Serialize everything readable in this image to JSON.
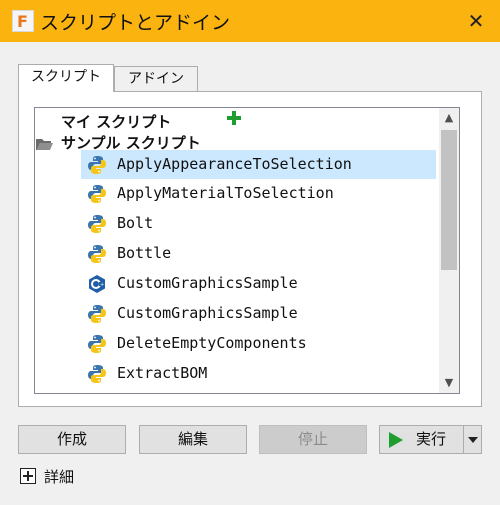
{
  "window": {
    "title": "スクリプトとアドイン",
    "close_glyph": "✕"
  },
  "tabs": [
    {
      "label": "スクリプト",
      "active": true
    },
    {
      "label": "アドイン",
      "active": false
    }
  ],
  "tree": {
    "my_scripts_label": "マイ スクリプト",
    "samples_label": "サンプル スクリプト",
    "items": [
      {
        "label": "ApplyAppearanceToSelection",
        "icon": "python-icon",
        "selected": true
      },
      {
        "label": "ApplyMaterialToSelection",
        "icon": "python-icon"
      },
      {
        "label": "Bolt",
        "icon": "python-icon"
      },
      {
        "label": "Bottle",
        "icon": "python-icon"
      },
      {
        "label": "CustomGraphicsSample",
        "icon": "cpp-icon"
      },
      {
        "label": "CustomGraphicsSample",
        "icon": "python-icon"
      },
      {
        "label": "DeleteEmptyComponents",
        "icon": "python-icon"
      },
      {
        "label": "ExtractBOM",
        "icon": "python-icon"
      }
    ]
  },
  "buttons": {
    "create": "作成",
    "edit": "編集",
    "stop": "停止",
    "run": "実行"
  },
  "details_label": "詳細",
  "colors": {
    "titlebar": "#fbb30f",
    "selection": "#cce8ff",
    "accent_green": "#1e9e2e"
  }
}
